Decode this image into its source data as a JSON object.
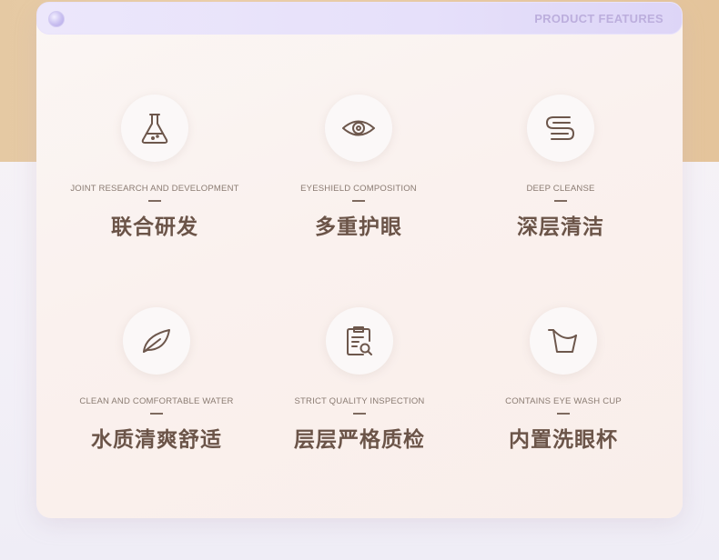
{
  "header": {
    "section_label": "PRODUCT FEATURES"
  },
  "features": [
    {
      "icon": "flask-icon",
      "en": "JOINT RESEARCH AND DEVELOPMENT",
      "cn": "联合研发"
    },
    {
      "icon": "eye-icon",
      "en": "EYESHIELD COMPOSITION",
      "cn": "多重护眼"
    },
    {
      "icon": "cleanse-icon",
      "en": "DEEP CLEANSE",
      "cn": "深层清洁"
    },
    {
      "icon": "leaf-icon",
      "en": "CLEAN AND COMFORTABLE WATER",
      "cn": "水质清爽舒适"
    },
    {
      "icon": "clipboard-search-icon",
      "en": "STRICT QUALITY INSPECTION",
      "cn": "层层严格质检"
    },
    {
      "icon": "cup-icon",
      "en": "CONTAINS EYE WASH CUP",
      "cn": "内置洗眼杯"
    }
  ],
  "colors": {
    "text_dark": "#6b5448",
    "text_muted": "#8a7b72",
    "accent_lavender": "#bcaedd"
  }
}
